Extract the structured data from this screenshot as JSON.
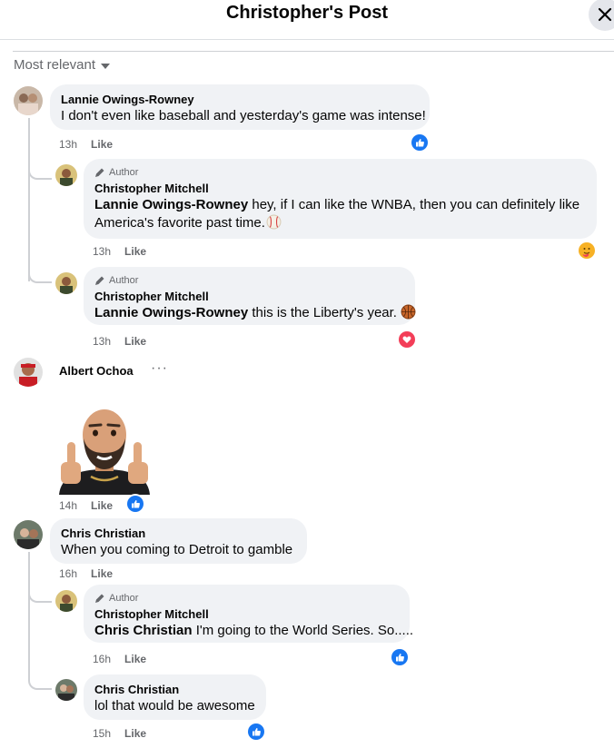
{
  "header": {
    "title": "Christopher's Post"
  },
  "sort": {
    "label": "Most relevant"
  },
  "colors": {
    "like_blue": "#1877f2",
    "love_red": "#f33e58",
    "bubble_bg": "#f0f2f5",
    "meta_gray": "#65676b"
  },
  "comments": [
    {
      "author": "Lannie Owings-Rowney",
      "text": "I don't even like baseball and yesterday's game was intense!",
      "time": "13h",
      "like_label": "Like",
      "reaction": "like-icon",
      "replies": [
        {
          "badge": "Author",
          "author": "Christopher Mitchell",
          "mention": "Lannie Owings-Rowney",
          "text_line1": " hey, if I can like the WNBA, then you can definitely like",
          "text_line2": "America's favorite past time.",
          "emoji": "baseball",
          "time": "13h",
          "like_label": "Like",
          "reaction": "care-icon"
        },
        {
          "badge": "Author",
          "author": "Christopher Mitchell",
          "mention": "Lannie Owings-Rowney",
          "text": " this is the Liberty's year.",
          "emoji": "basketball",
          "time": "13h",
          "like_label": "Like",
          "reaction": "love-icon"
        }
      ]
    },
    {
      "author": "Albert Ochoa",
      "more_label": "···",
      "sticker": "thumbs-up-avatar-sticker",
      "time": "14h",
      "like_label": "Like",
      "reaction": "like-icon"
    },
    {
      "author": "Chris Christian",
      "text": "When you coming to Detroit to gamble",
      "time": "16h",
      "like_label": "Like",
      "replies": [
        {
          "badge": "Author",
          "author": "Christopher Mitchell",
          "mention": "Chris Christian",
          "text": " I'm going to the World Series. So.....",
          "time": "16h",
          "like_label": "Like",
          "reaction": "like-icon"
        },
        {
          "author": "Chris Christian",
          "text": "lol that would be awesome",
          "time": "15h",
          "like_label": "Like",
          "reaction": "like-icon"
        }
      ]
    }
  ]
}
